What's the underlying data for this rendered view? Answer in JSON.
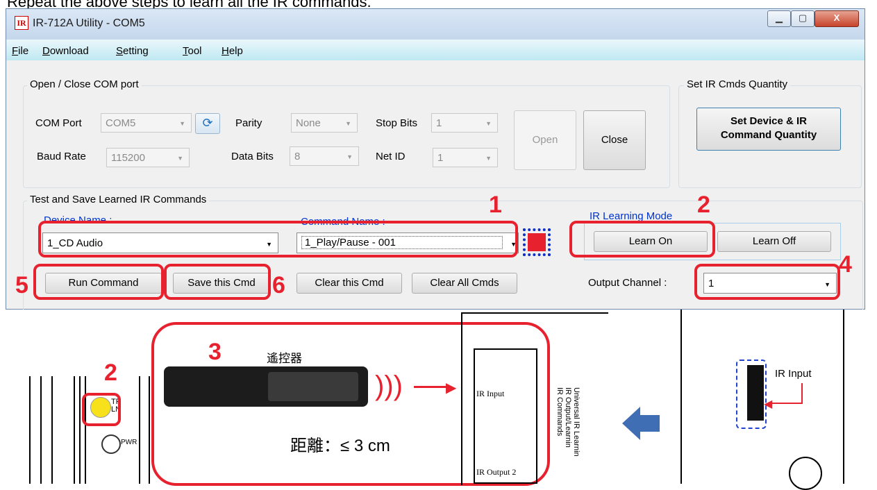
{
  "caption": "Repeat the above steps to learn all the IR commands.",
  "window": {
    "icon_text": "IR",
    "title": "IR-712A Utility - COM5",
    "controls": {
      "minimize": "▁",
      "maximize": "▢",
      "close": "X"
    }
  },
  "menu": [
    {
      "label": "File",
      "ul": "F",
      "rest": "ile"
    },
    {
      "label": "Download",
      "ul": "D",
      "rest": "ownload"
    },
    {
      "label": "Setting",
      "ul": "S",
      "rest": "etting"
    },
    {
      "label": "Tool",
      "ul": "T",
      "rest": "ool"
    },
    {
      "label": "Help",
      "ul": "H",
      "rest": "elp"
    }
  ],
  "com_group": {
    "title": "Open / Close COM port",
    "com_port_label": "COM Port",
    "com_port_value": "COM5",
    "parity_label": "Parity",
    "parity_value": "None",
    "stop_bits_label": "Stop Bits",
    "stop_bits_value": "1",
    "baud_rate_label": "Baud Rate",
    "baud_rate_value": "115200",
    "data_bits_label": "Data Bits",
    "data_bits_value": "8",
    "net_id_label": "Net ID",
    "net_id_value": "1",
    "open_label": "Open",
    "close_label": "Close"
  },
  "qty_group": {
    "title": "Set IR Cmds Quantity",
    "button_line1": "Set Device & IR",
    "button_line2": "Command Quantity"
  },
  "learn_group": {
    "title": "Test and Save Learned IR Commands",
    "device_name_label": "Device Name :",
    "device_name_value": "1_CD Audio",
    "command_name_label": "Command Name :",
    "command_name_value": "1_Play/Pause - 001",
    "status_color": "#e8212f",
    "ir_learning_mode_label": "IR Learning Mode",
    "learn_on_label": "Learn On",
    "learn_off_label": "Learn Off",
    "output_channel_label": "Output Channel :",
    "output_channel_value": "1",
    "run_command_label": "Run Command",
    "save_cmd_label": "Save this Cmd",
    "clear_cmd_label": "Clear this Cmd",
    "clear_all_label": "Clear All Cmds"
  },
  "annotations": {
    "step1": "1",
    "step2": "2",
    "step3": "3",
    "step4": "4",
    "step5": "5",
    "step6": "6",
    "step2b": "2",
    "accent_color": "#e8212f"
  },
  "illustration": {
    "remote_label": "遙控器",
    "distance_label": "距離：≤ 3 cm",
    "led_tr": "TR",
    "led_ln": "LN",
    "led_pwr": "PWR",
    "ir_input_small": "IR Input",
    "ir_output2": "IR Output 2",
    "side_text_1": "Universal IR Learnin",
    "side_text_2": "IR Output/Learnin",
    "side_text_3": "IR Commands",
    "ir_input_big": "IR Input"
  }
}
